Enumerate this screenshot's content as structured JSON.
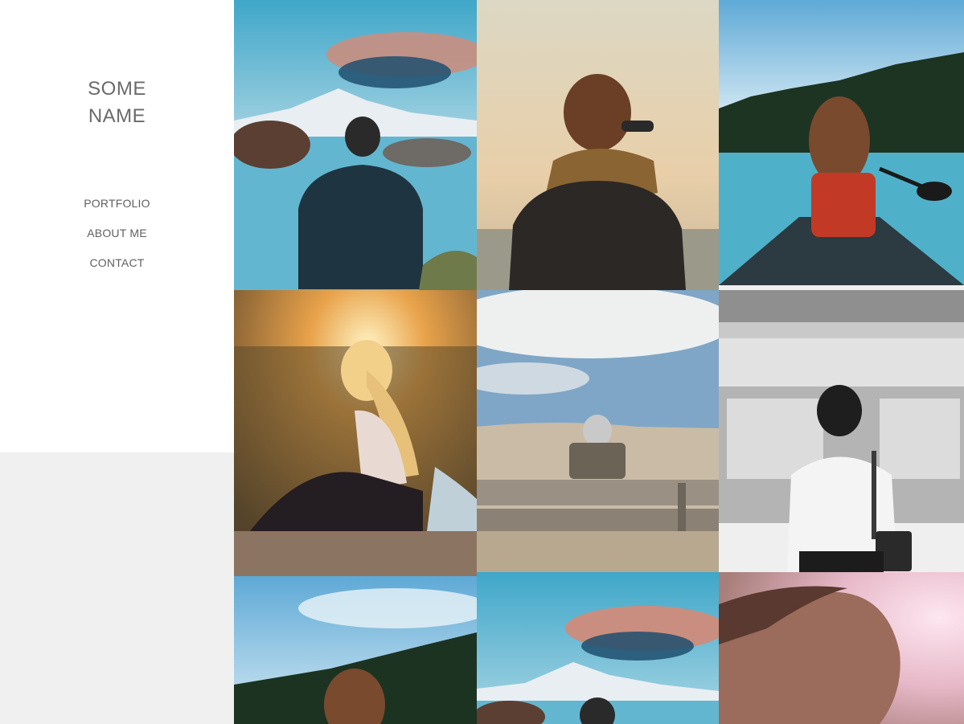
{
  "sidebar": {
    "brand_line1": "SOME",
    "brand_line2": "NAME",
    "nav": [
      {
        "label": "PORTFOLIO"
      },
      {
        "label": "ABOUT ME"
      },
      {
        "label": "CONTACT"
      }
    ]
  },
  "gallery": {
    "photos": [
      {
        "subject": "man-mountain-lake"
      },
      {
        "subject": "person-scarf-sunglasses"
      },
      {
        "subject": "woman-canoe-lake"
      },
      {
        "subject": "woman-sunset-hillside"
      },
      {
        "subject": "person-bench-dunes"
      },
      {
        "subject": "woman-subway-platform"
      },
      {
        "subject": "woman-canoe-lake"
      },
      {
        "subject": "man-mountain-lake"
      },
      {
        "subject": "woman-portrait-pink-light"
      }
    ]
  },
  "colors": {
    "sidebar_bg": "#ffffff",
    "page_bg": "#f0f0f0",
    "text": "#6a6a6a"
  }
}
